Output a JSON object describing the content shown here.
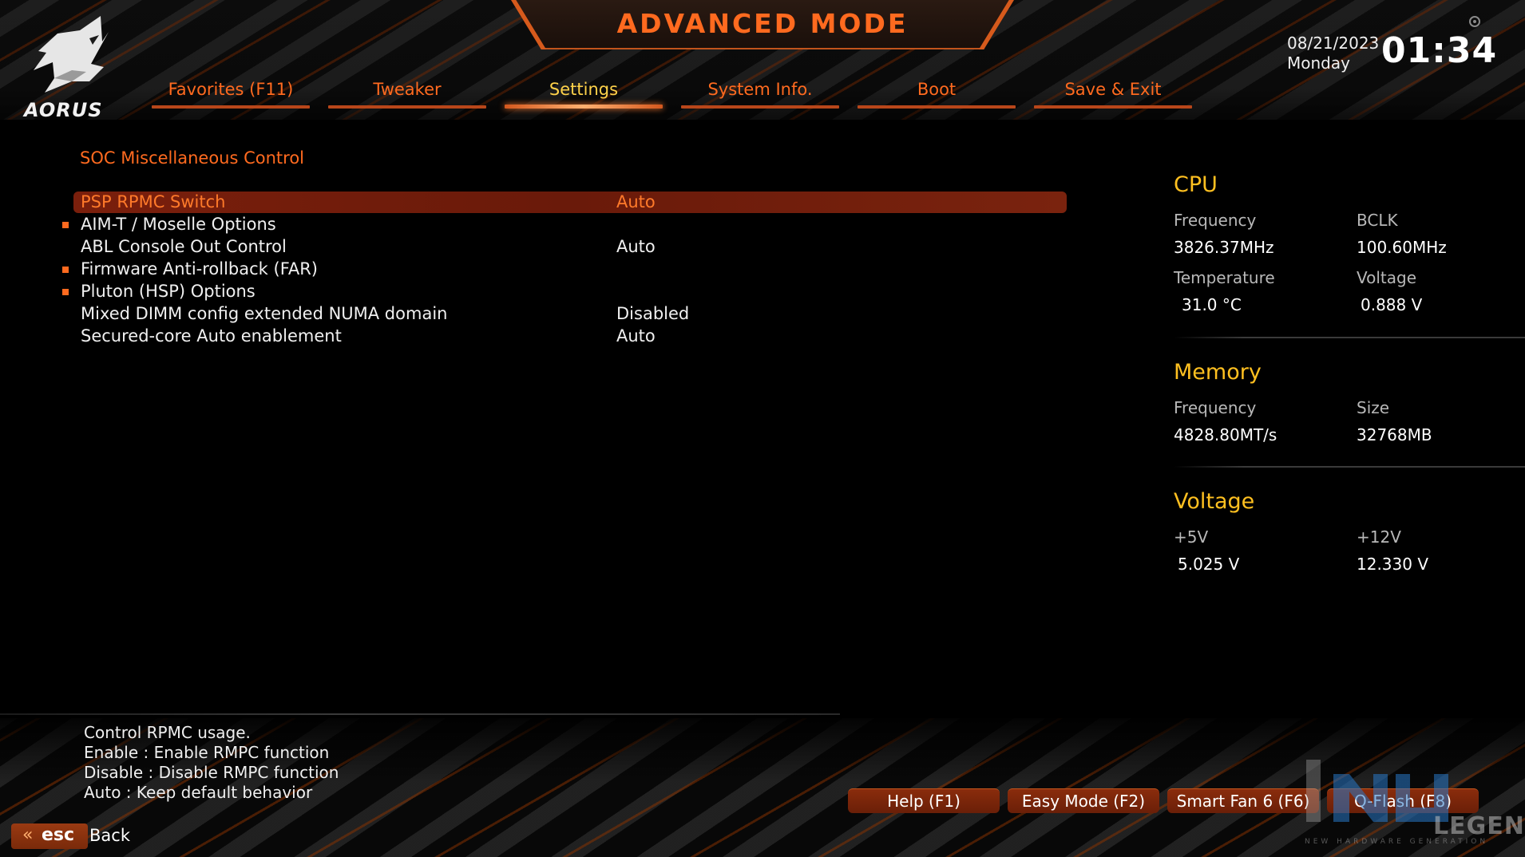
{
  "header": {
    "title": "ADVANCED MODE",
    "logo_text": "AORUS",
    "date": "08/21/2023",
    "day": "Monday",
    "time": "01:34"
  },
  "tabs": [
    {
      "label": "Favorites (F11)",
      "active": false
    },
    {
      "label": "Tweaker",
      "active": false
    },
    {
      "label": "Settings",
      "active": true
    },
    {
      "label": "System Info.",
      "active": false
    },
    {
      "label": "Boot",
      "active": false
    },
    {
      "label": "Save & Exit",
      "active": false
    }
  ],
  "section": {
    "title": "SOC Miscellaneous Control"
  },
  "settings": [
    {
      "name": "PSP RPMC Switch",
      "value": "Auto"
    },
    {
      "name": "AIM-T / Moselle Options",
      "value": ""
    },
    {
      "name": "ABL Console Out Control",
      "value": "Auto"
    },
    {
      "name": "Firmware Anti-rollback (FAR)",
      "value": ""
    },
    {
      "name": "Pluton (HSP) Options",
      "value": ""
    },
    {
      "name": "Mixed DIMM config extended NUMA domain",
      "value": "Disabled"
    },
    {
      "name": "Secured-core Auto enablement",
      "value": "Auto"
    }
  ],
  "panel": {
    "cpu": {
      "title": "CPU",
      "frequency_label": "Frequency",
      "frequency_value": "3826.37MHz",
      "bclk_label": "BCLK",
      "bclk_value": "100.60MHz",
      "temperature_label": "Temperature",
      "temperature_value": "31.0 °C",
      "voltage_label": "Voltage",
      "voltage_value": "0.888 V"
    },
    "memory": {
      "title": "Memory",
      "frequency_label": "Frequency",
      "frequency_value": "4828.80MT/s",
      "size_label": "Size",
      "size_value": "32768MB"
    },
    "voltage": {
      "title": "Voltage",
      "v5_label": "+5V",
      "v5_value": "5.025 V",
      "v12_label": "+12V",
      "v12_value": "12.330 V"
    }
  },
  "description": {
    "lines": [
      "Control RPMC usage.",
      "Enable : Enable RMPC function",
      "Disable : Disable RMPC function",
      "Auto : Keep default behavior"
    ]
  },
  "footer": {
    "esc_label": "esc",
    "back_label": "Back",
    "help_label": "Help (F1)",
    "easy_mode_label": "Easy Mode (F2)",
    "smart_fan_label": "Smart Fan 6 (F6)",
    "qflash_label": "Q-Flash (F8)"
  },
  "watermark": {
    "text": "LEGEND",
    "sub": "NEW HARDWARE GENERATION"
  },
  "colors": {
    "accent": "#ff6a1f",
    "active_tab": "#ffd24a",
    "panel_head": "#ffc020",
    "selected_row": "#7a1f0c"
  }
}
